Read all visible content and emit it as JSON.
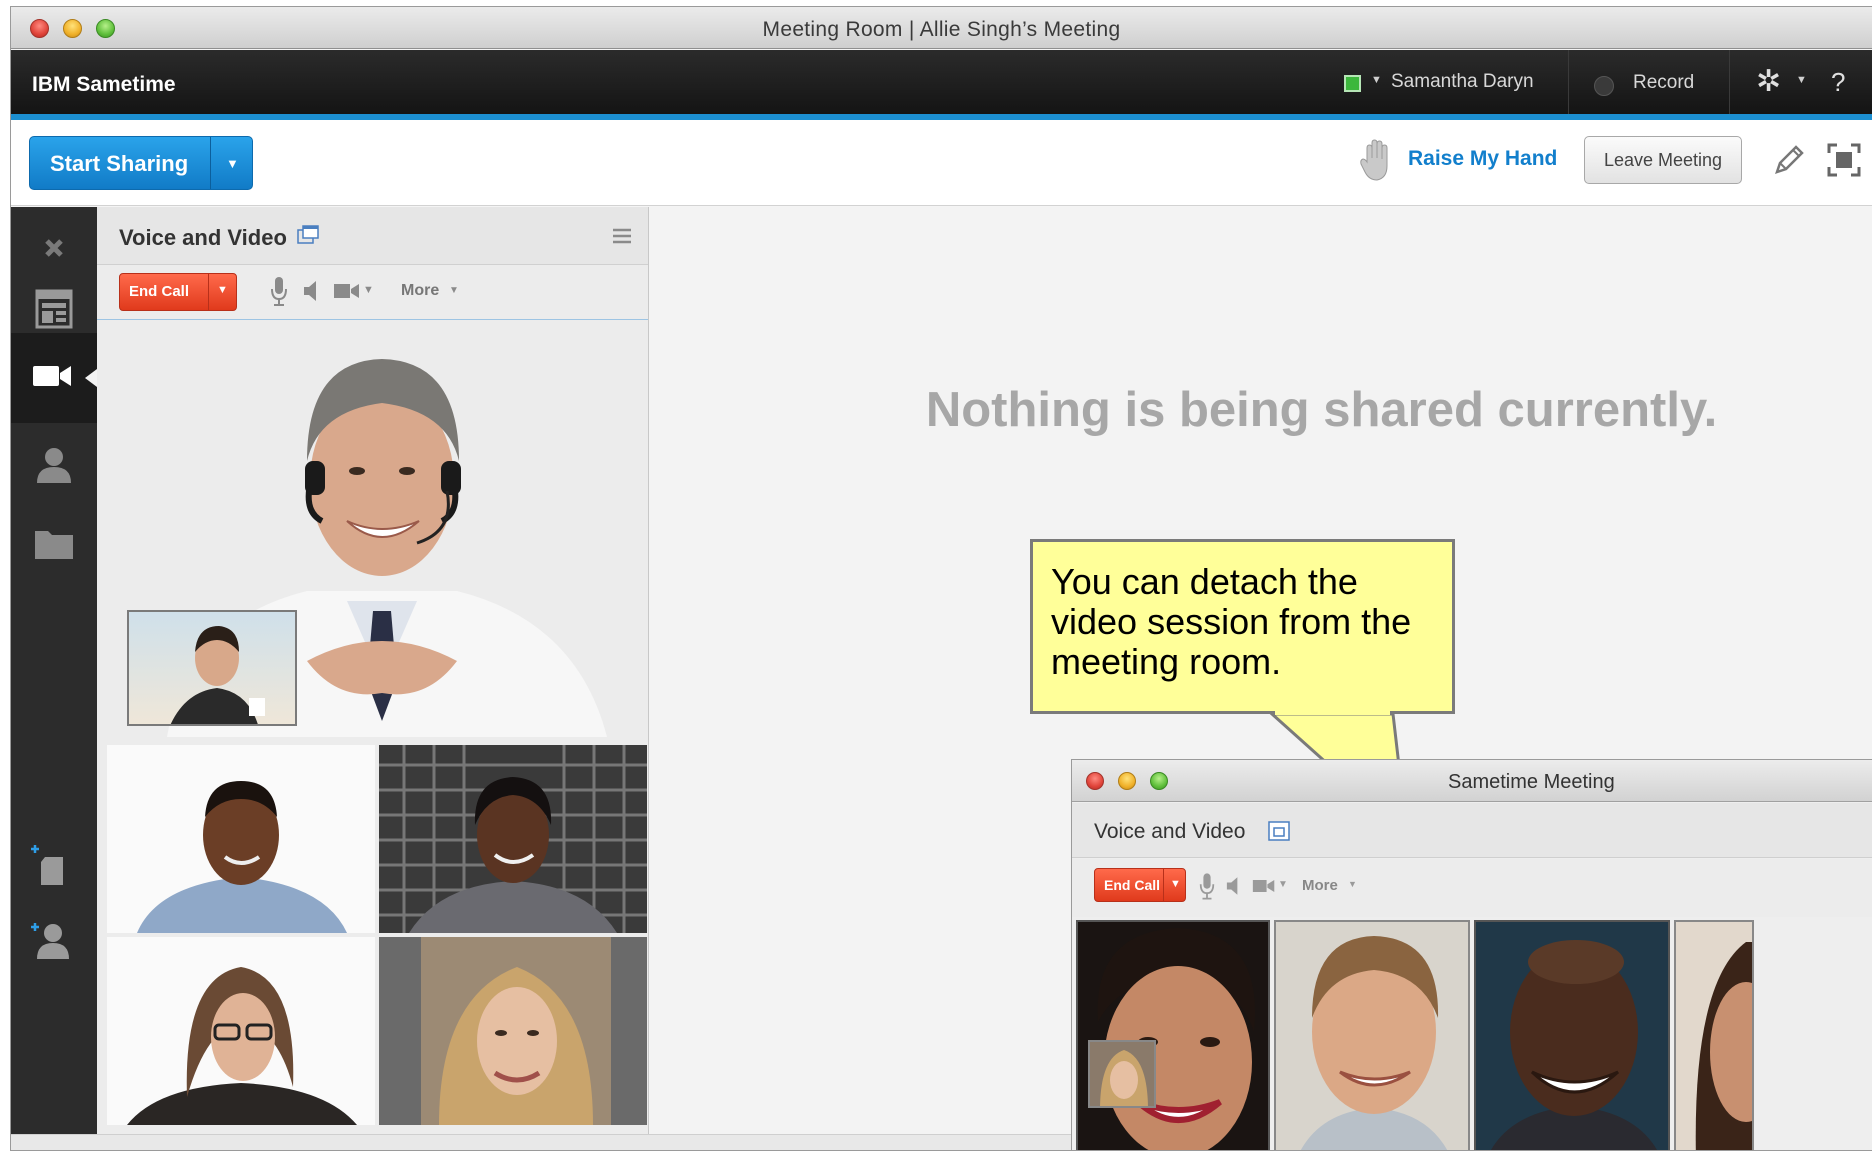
{
  "window": {
    "title": "Meeting Room  |  Allie Singh’s Meeting"
  },
  "appbar": {
    "brand": "IBM Sametime",
    "user_name": "Samantha Daryn",
    "status_color": "#3cb73c",
    "record_label": "Record",
    "help_label": "?",
    "accent_color": "#1c8fd1"
  },
  "toolbar": {
    "start_sharing_label": "Start Sharing",
    "raise_hand_label": "Raise My Hand",
    "leave_meeting_label": "Leave Meeting"
  },
  "rail": {
    "items": [
      "close-icon",
      "layout-icon",
      "video-camera-icon",
      "person-icon",
      "folder-icon",
      "add-file-icon",
      "add-person-icon"
    ],
    "selected": "video-camera-icon"
  },
  "voice_video_panel": {
    "title": "Voice and Video",
    "end_call_label": "End Call",
    "more_label": "More"
  },
  "stage": {
    "message": "Nothing is being shared currently."
  },
  "callout": {
    "text": "You can detach the video session from the meeting room."
  },
  "detached_window": {
    "title": "Sametime Meeting",
    "panel_title": "Voice and Video",
    "end_call_label": "End Call",
    "more_label": "More"
  }
}
